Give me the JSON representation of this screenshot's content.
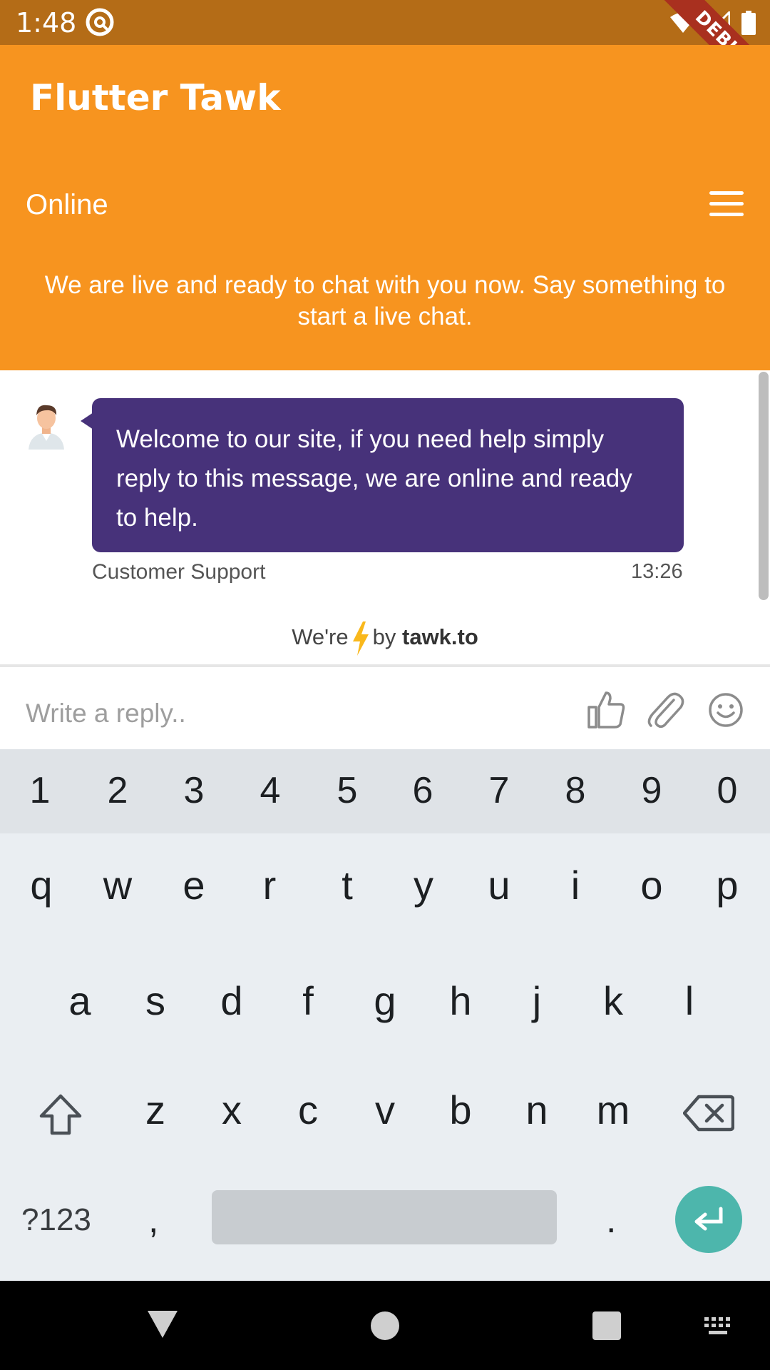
{
  "status_bar": {
    "time": "1:48",
    "debug_label": "DEBUG"
  },
  "app_bar": {
    "title": "Flutter Tawk"
  },
  "widget_header": {
    "status": "Online",
    "intro": "We are live and ready to chat with you now. Say something to start a live chat."
  },
  "chat": {
    "messages": [
      {
        "text": "Welcome to our site, if you need help simply reply to this message, we are online and ready to help.",
        "sender": "Customer Support",
        "time": "13:26"
      }
    ],
    "powered_prefix": "We're",
    "powered_by": "by",
    "powered_brand": "tawk.to"
  },
  "reply": {
    "placeholder": "Write a reply..",
    "icons": [
      "thumbs-up-icon",
      "paperclip-icon",
      "emoji-icon"
    ]
  },
  "keyboard": {
    "numbers": [
      "1",
      "2",
      "3",
      "4",
      "5",
      "6",
      "7",
      "8",
      "9",
      "0"
    ],
    "row1": [
      "q",
      "w",
      "e",
      "r",
      "t",
      "y",
      "u",
      "i",
      "o",
      "p"
    ],
    "row2": [
      "a",
      "s",
      "d",
      "f",
      "g",
      "h",
      "j",
      "k",
      "l"
    ],
    "row3": [
      "z",
      "x",
      "c",
      "v",
      "b",
      "n",
      "m"
    ],
    "symbols_key": "?123",
    "comma": ",",
    "period": "."
  },
  "colors": {
    "status_bar": "#b46c17",
    "app_bar": "#f7941f",
    "bubble": "#47327a",
    "enter_key": "#4db6ac",
    "debug_banner": "#a9301f"
  }
}
